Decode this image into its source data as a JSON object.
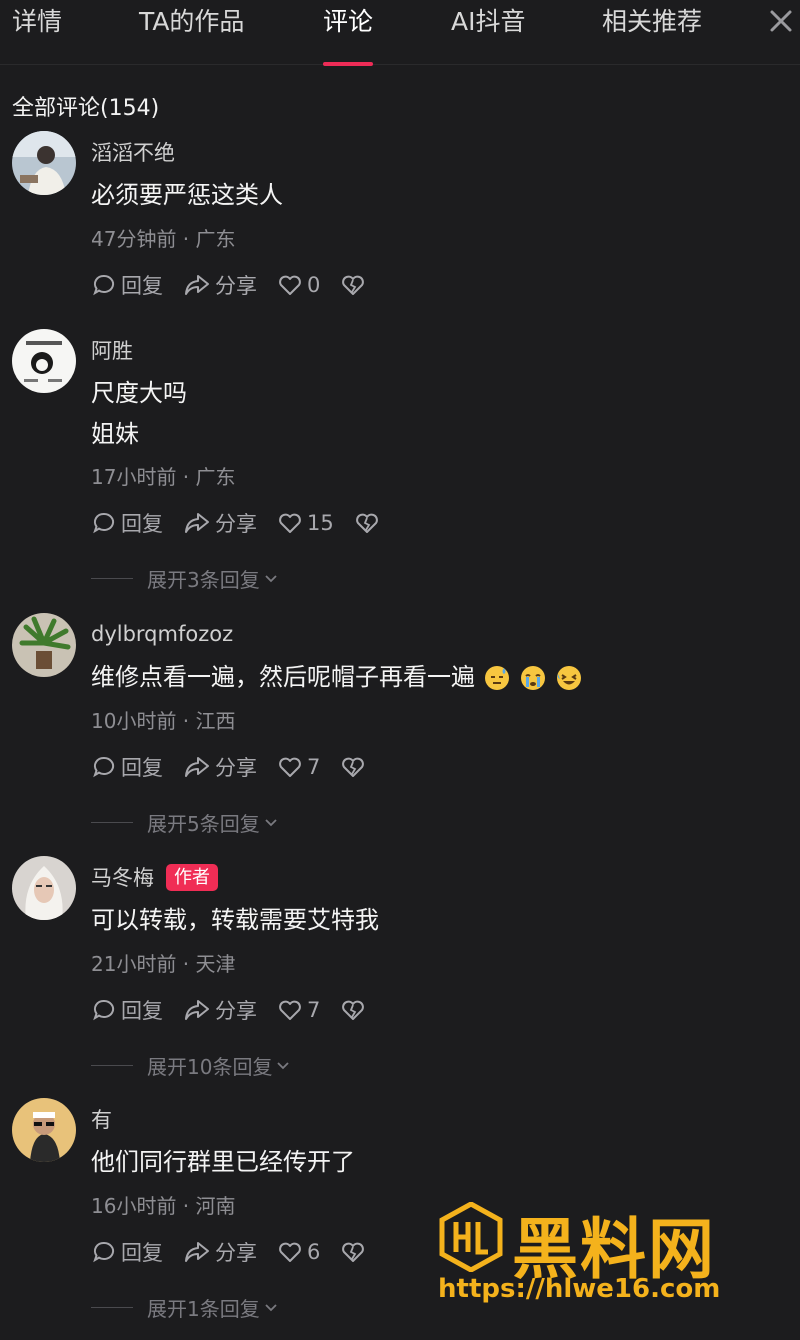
{
  "tabs": [
    {
      "label": "详情"
    },
    {
      "label": "TA的作品"
    },
    {
      "label": "评论"
    },
    {
      "label": "AI抖音"
    },
    {
      "label": "相关推荐"
    }
  ],
  "active_tab": "评论",
  "comments_header": "全部评论(154)",
  "actions": {
    "reply": "回复",
    "share": "分享"
  },
  "comments": [
    {
      "author": "滔滔不绝",
      "lines": [
        "必须要严惩这类人"
      ],
      "meta": "47分钟前 · 广东",
      "likes": "0"
    },
    {
      "author": "阿胜",
      "lines": [
        "尺度大吗",
        "姐妹"
      ],
      "meta": "17小时前 · 广东",
      "likes": "15",
      "expand": "展开3条回复"
    },
    {
      "author": "dylbrqmfozoz",
      "lines": [
        "维修点看一遍，然后呢帽子再看一遍"
      ],
      "emojis": [
        "sweat-sleep-emoji",
        "crying-emoji",
        "laughing-tears-emoji"
      ],
      "meta": "10小时前 · 江西",
      "likes": "7",
      "expand": "展开5条回复"
    },
    {
      "author": "马冬梅",
      "badge": "作者",
      "lines": [
        "可以转载，转载需要艾特我"
      ],
      "meta": "21小时前 · 天津",
      "likes": "7",
      "expand": "展开10条回复"
    },
    {
      "author": "有",
      "lines": [
        "他们同行群里已经传开了"
      ],
      "meta": "16小时前 · 河南",
      "likes": "6",
      "expand": "展开1条回复"
    }
  ],
  "watermark": {
    "title": "黑料网",
    "url": "https://hlwe16.com"
  },
  "colors": {
    "background": "#1c1c1e",
    "accent": "#ee2c57",
    "badge": "#f02d55",
    "watermark": "#f4b21c"
  }
}
